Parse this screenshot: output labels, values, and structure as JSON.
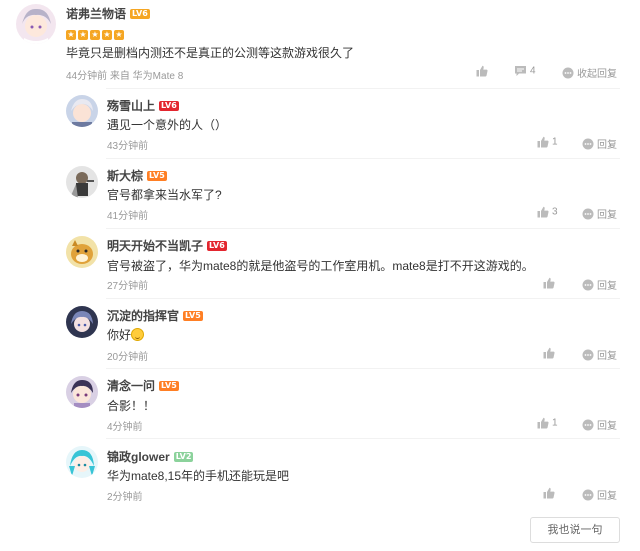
{
  "main": {
    "username": "诺弗兰物语",
    "level": "LV6",
    "level_color": "#f5a623",
    "text": "毕竟只是删档内测还不是真正的公测等这款游戏很久了",
    "meta": "44分钟前 来自 华为Mate 8",
    "likes": "",
    "replies": "4",
    "collapse_label": "收起回复"
  },
  "replies": [
    {
      "username": "殇雪山上",
      "level": "LV6",
      "level_color": "#e3262f",
      "text": "遇见一个意外的人（）",
      "time": "43分钟前",
      "likes": "1",
      "reply_label": "回复"
    },
    {
      "username": "斯大棕",
      "level": "LV5",
      "level_color": "#ff7f24",
      "text": "官号都拿来当水军了?",
      "time": "41分钟前",
      "likes": "3",
      "reply_label": "回复"
    },
    {
      "username": "明天开始不当凯子",
      "level": "LV6",
      "level_color": "#e3262f",
      "text": "官号被盗了，华为mate8的就是他盗号的工作室用机。mate8是打不开这游戏的。",
      "time": "27分钟前",
      "likes": "",
      "reply_label": "回复"
    },
    {
      "username": "沉淀的指挥官",
      "level": "LV5",
      "level_color": "#ff7f24",
      "text": "你好",
      "time": "20分钟前",
      "likes": "",
      "reply_label": "回复"
    },
    {
      "username": "清念一问",
      "level": "LV5",
      "level_color": "#ff7f24",
      "text": "合影！！",
      "time": "4分钟前",
      "likes": "1",
      "reply_label": "回复"
    },
    {
      "username": "锦政glower",
      "level": "LV2",
      "level_color": "#8bd29b",
      "text": "华为mate8,15年的手机还能玩是吧",
      "time": "2分钟前",
      "likes": "",
      "reply_label": "回复"
    }
  ],
  "reply_button_label": "我也说一句",
  "icons": {
    "like": "thumbs-up-icon",
    "comment": "comment-icon",
    "reply": "reply-icon",
    "star": "star-icon",
    "emoji": "smile-emoji-icon"
  }
}
